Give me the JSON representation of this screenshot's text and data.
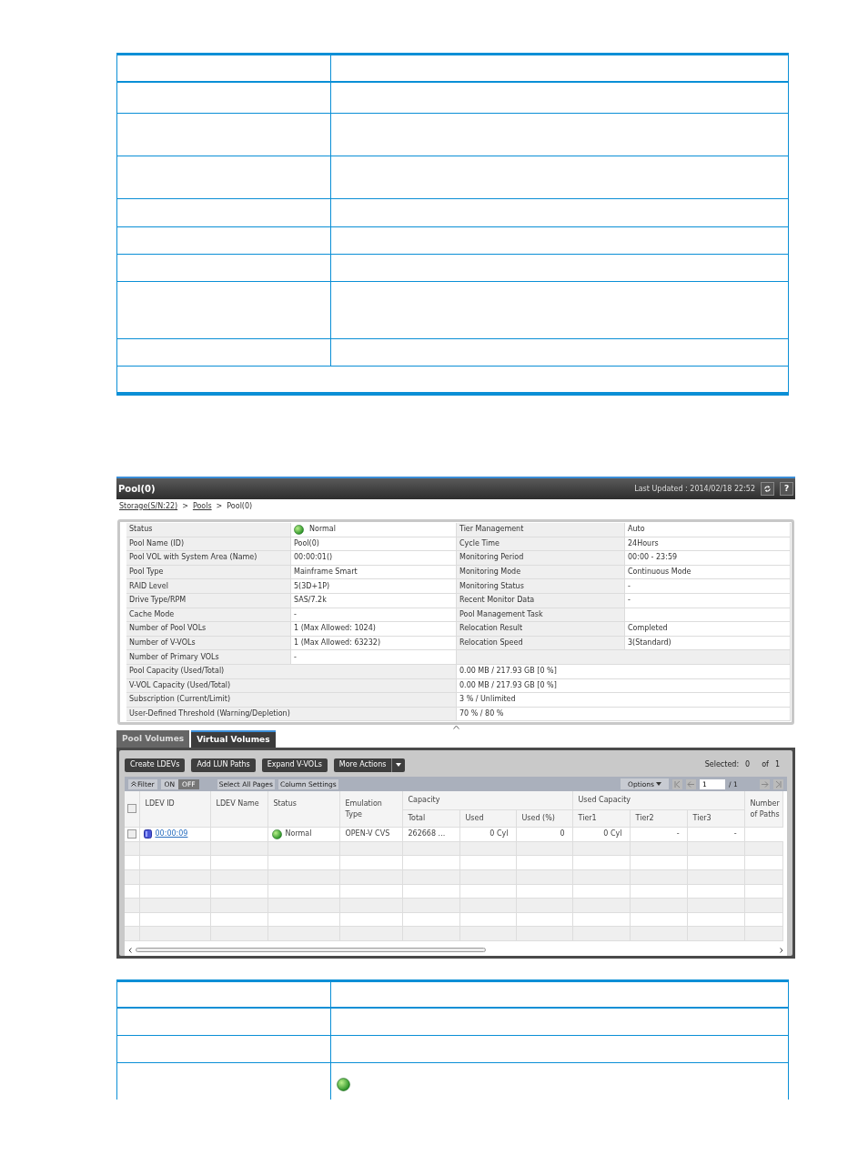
{
  "pool_window": {
    "title": "Pool(0)",
    "last_updated": "Last Updated : 2014/02/18 22:52",
    "help": "?",
    "select_all_checked": false,
    "breadcrumb": [
      {
        "text": "Storage(S/N:22)",
        "kind": "link"
      },
      {
        "text": ">",
        "kind": "separator"
      },
      {
        "text": "Pools",
        "kind": "link"
      },
      {
        "text": ">",
        "kind": "separator"
      },
      {
        "text": "Pool(0)",
        "kind": "current"
      }
    ],
    "summary_left": [
      {
        "label": "Status",
        "value": "Normal",
        "kind": "status"
      },
      {
        "label": "Pool Name (ID)",
        "value": "Pool(0)",
        "kind": "text"
      },
      {
        "label": "Pool VOL with System Area (Name)",
        "value": "00:00:01()",
        "kind": "text"
      },
      {
        "label": "Pool Type",
        "value": "Mainframe Smart",
        "kind": "text"
      },
      {
        "label": "RAID Level",
        "value": "5(3D+1P)",
        "kind": "text"
      },
      {
        "label": "Drive Type/RPM",
        "value": "SAS/7.2k",
        "kind": "text"
      },
      {
        "label": "Cache Mode",
        "value": "-",
        "kind": "text"
      },
      {
        "label": "Number of Pool VOLs",
        "value": "1 (Max Allowed: 1024)",
        "kind": "text"
      },
      {
        "label": "Number of V-VOLs",
        "value": "1 (Max Allowed: 63232)",
        "kind": "text"
      },
      {
        "label": "Number of Primary VOLs",
        "value": "-",
        "kind": "text"
      }
    ],
    "summary_right": [
      {
        "label": "Tier Management",
        "value": "Auto"
      },
      {
        "label": "Cycle Time",
        "value": "24Hours"
      },
      {
        "label": "Monitoring Period",
        "value": "00:00 - 23:59"
      },
      {
        "label": "Monitoring Mode",
        "value": "Continuous Mode"
      },
      {
        "label": "Monitoring Status",
        "value": "-"
      },
      {
        "label": "Recent Monitor Data",
        "value": "-"
      },
      {
        "label": "Pool Management Task"
      },
      {
        "label": "Relocation Result",
        "value": "Completed"
      },
      {
        "label": "Relocation Speed",
        "value": "3(Standard)"
      }
    ],
    "summary_wide": [
      {
        "label": "Pool Capacity (Used/Total)",
        "value": "0.00 MB / 217.93 GB [0 %]"
      },
      {
        "label": "V-VOL Capacity (Used/Total)",
        "value": "0.00 MB / 217.93 GB [0 %]"
      },
      {
        "label": "Subscription (Current/Limit)",
        "value": "3 % / Unlimited"
      },
      {
        "label": "User-Defined Threshold (Warning/Depletion)",
        "value": "70 % / 80 %"
      }
    ],
    "tabs": [
      {
        "label": "Pool Volumes",
        "selected": false
      },
      {
        "label": "Virtual Volumes",
        "selected": true
      }
    ],
    "actions": [
      "Create LDEVs",
      "Add LUN Paths",
      "Expand V-VOLs"
    ],
    "more_actions": "More Actions",
    "selection": {
      "label": "Selected:",
      "count": "0",
      "of": "of",
      "total": "1"
    },
    "filter": {
      "label": "Filter",
      "on_label": "ON",
      "off_label": "OFF",
      "on": false
    },
    "table_buttons": [
      "Select All Pages",
      "Column Settings"
    ],
    "options": "Options",
    "pagination": {
      "page": "1",
      "pages": "/ 1"
    },
    "columns": [
      {
        "label": "LDEV ID"
      },
      {
        "label": "LDEV Name"
      },
      {
        "label": "Status"
      },
      {
        "label": "Emulation Type"
      },
      {
        "label": "Capacity",
        "children": [
          "Total",
          "Used",
          "Used (%)"
        ]
      },
      {
        "label": "Used Capacity",
        "children": [
          "Tier1",
          "Tier2",
          "Tier3"
        ]
      },
      {
        "label": "Number of Paths"
      }
    ],
    "rows": [
      {
        "checked": false,
        "ldev_id": "00:00:09",
        "status": "Normal",
        "emulation_type": "OPEN-V CVS",
        "total": "262668 ...",
        "used": "0 Cyl",
        "used_pct": "0",
        "tier1": "0 Cyl",
        "tier2": "-",
        "tier3": "-"
      }
    ]
  }
}
